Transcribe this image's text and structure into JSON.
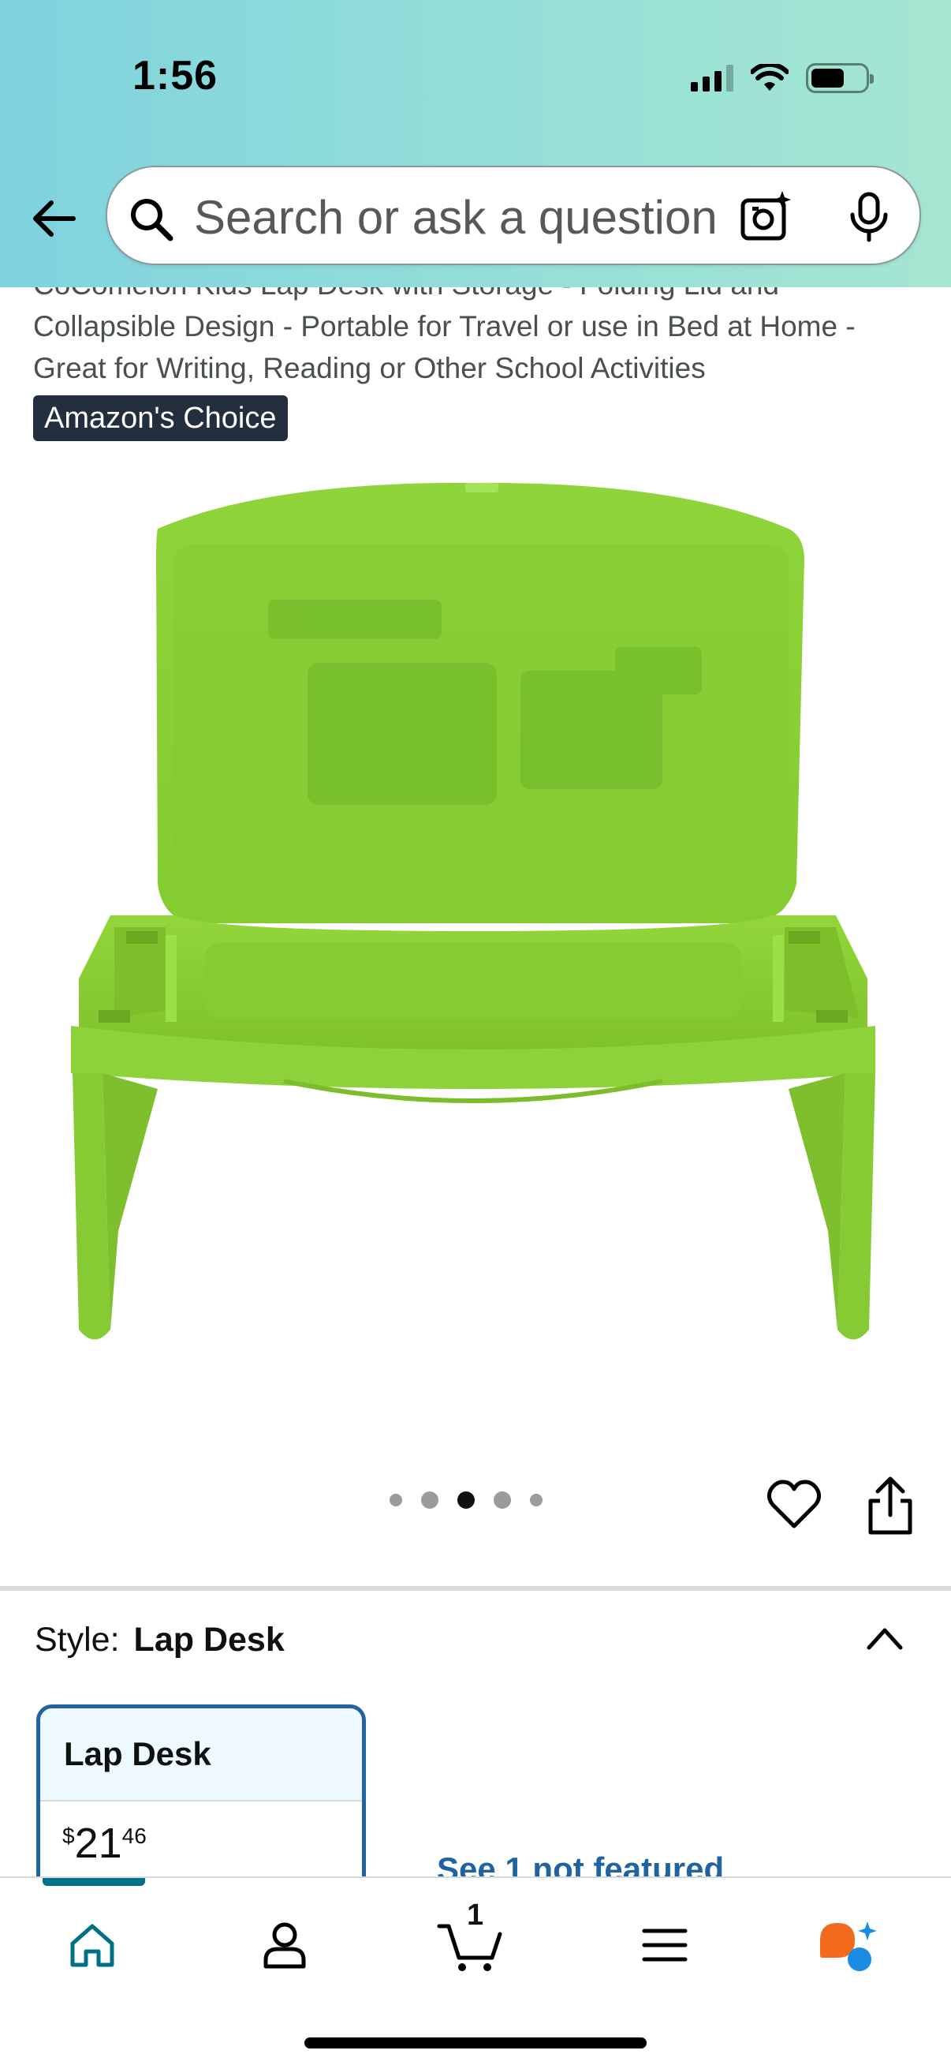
{
  "status_bar": {
    "time": "1:56"
  },
  "search": {
    "placeholder": "Search or ask a question"
  },
  "product": {
    "title": "CoComelon Kids Lap Desk with Storage - Folding Lid and Collapsible Design - Portable for Travel or use in Bed at Home - Great for Writing, Reading or Other School Activities",
    "badge": "Amazon's Choice",
    "image_count": 5,
    "active_image_index": 2,
    "product_color": "#8fd43a"
  },
  "style": {
    "label": "Style:",
    "selected": "Lap Desk",
    "option": {
      "name": "Lap Desk",
      "price_symbol": "$",
      "price_whole": "21",
      "price_fraction": "46"
    },
    "see_more": "See 1 not featured"
  },
  "nav": {
    "cart_count": "1",
    "items": [
      "home-icon",
      "account-icon",
      "cart-icon",
      "menu-icon",
      "rufus-icon"
    ]
  },
  "colors": {
    "header_start": "#7fd3de",
    "header_end": "#a5e6d2",
    "accent": "#007185",
    "link": "#2162a1",
    "badge_bg": "#232f3e"
  }
}
